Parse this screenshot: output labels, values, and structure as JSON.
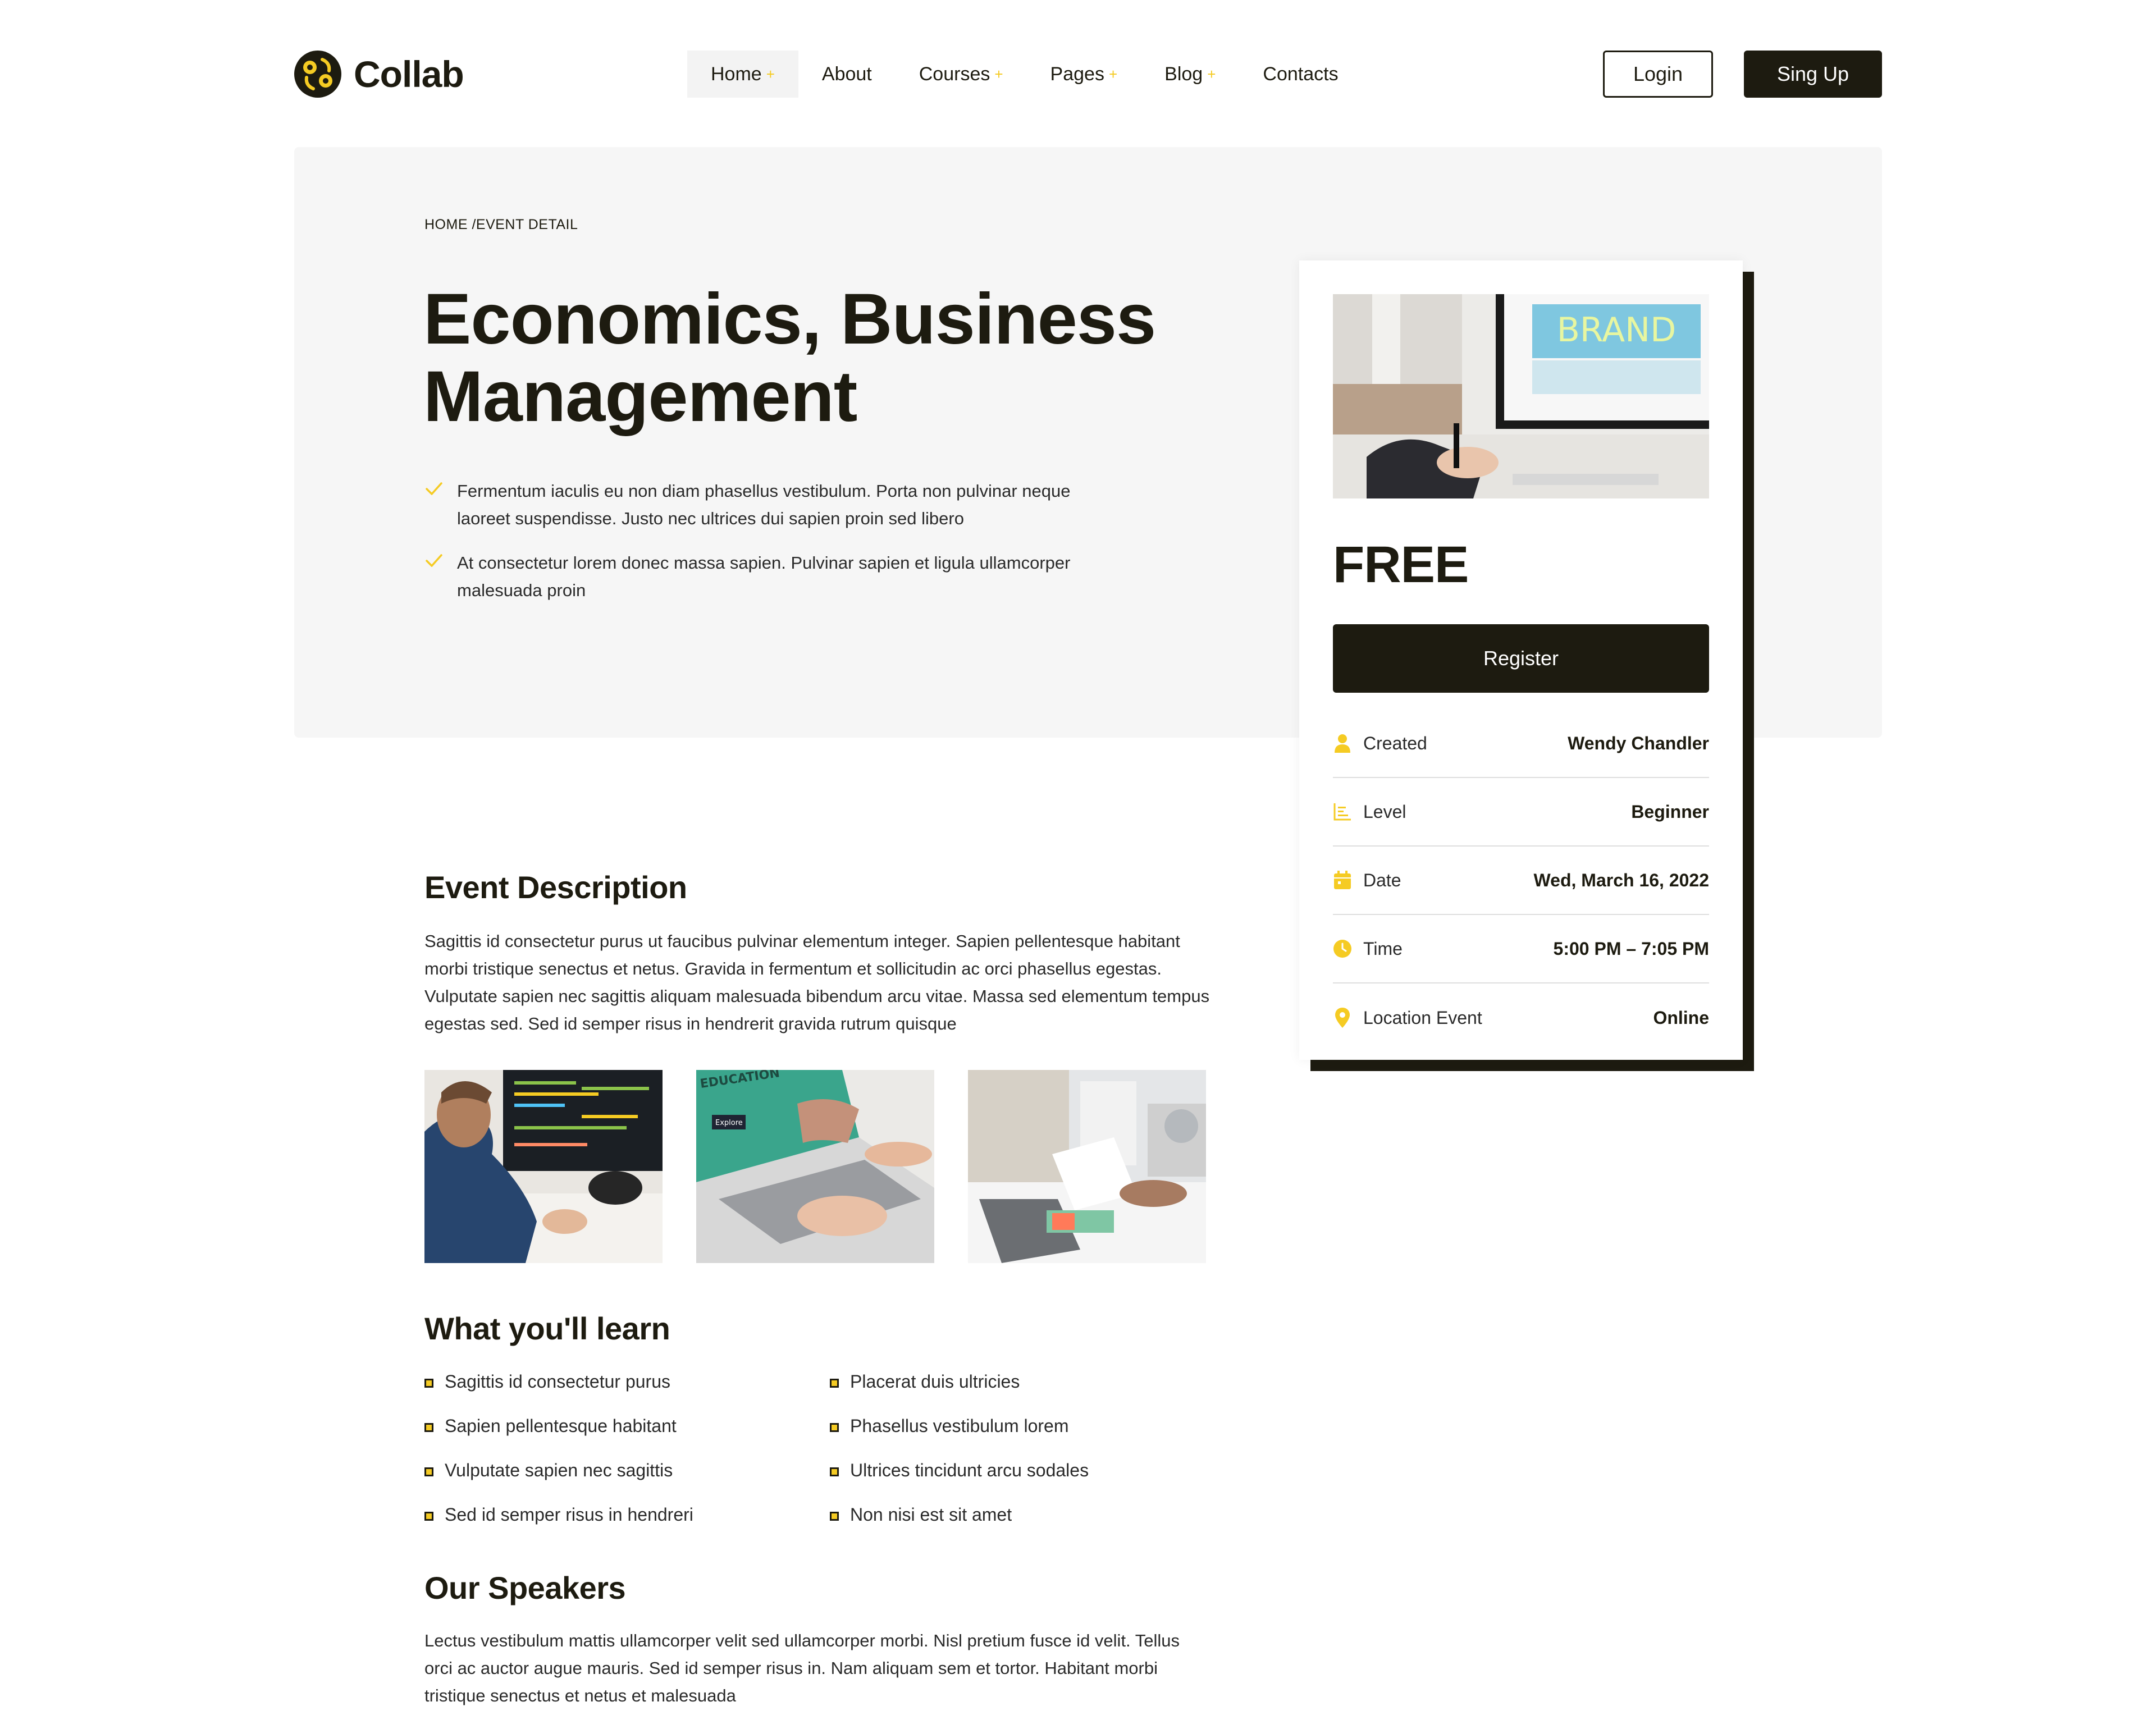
{
  "brand": {
    "name": "Collab",
    "logo_icon": "collab-logo-icon",
    "accent_color": "#f5cb23",
    "dark_color": "#1d1b10"
  },
  "nav": {
    "items": [
      {
        "label": "Home",
        "has_submenu": true,
        "active": true
      },
      {
        "label": "About",
        "has_submenu": false,
        "active": false
      },
      {
        "label": "Courses",
        "has_submenu": true,
        "active": false
      },
      {
        "label": "Pages",
        "has_submenu": true,
        "active": false
      },
      {
        "label": "Blog",
        "has_submenu": true,
        "active": false
      },
      {
        "label": "Contacts",
        "has_submenu": false,
        "active": false
      }
    ],
    "submenu_icon": "+",
    "login_label": "Login",
    "signup_label": "Sing Up"
  },
  "hero": {
    "breadcrumb": "HOME /EVENT DETAIL",
    "title_line1": "Economics, Business",
    "title_line2": "Management",
    "bullets": [
      "Fermentum iaculis eu non diam phasellus vestibulum. Porta non pulvinar neque laoreet suspendisse. Justo nec ultrices dui sapien proin sed libero",
      "At consectetur lorem donec massa sapien. Pulvinar sapien et ligula ullamcorper malesuada proin"
    ]
  },
  "event_card": {
    "image_text": "BRAND",
    "price": "FREE",
    "register_label": "Register",
    "details": [
      {
        "icon": "user-icon",
        "label": "Created",
        "value": "Wendy Chandler"
      },
      {
        "icon": "level-chart-icon",
        "label": "Level",
        "value": "Beginner"
      },
      {
        "icon": "calendar-icon",
        "label": "Date",
        "value": "Wed, March 16, 2022"
      },
      {
        "icon": "clock-icon",
        "label": "Time",
        "value": "5:00 PM – 7:05 PM"
      },
      {
        "icon": "location-pin-icon",
        "label": "Location Event",
        "value": "Online"
      }
    ]
  },
  "description": {
    "heading": "Event Description",
    "text": "Sagittis id consectetur purus ut faucibus pulvinar elementum integer. Sapien pellentesque habitant morbi tristique senectus et netus. Gravida in fermentum et sollicitudin ac orci phasellus egestas. Vulputate sapien nec sagittis aliquam malesuada bibendum arcu vitae. Massa sed elementum tempus egestas sed. Sed id semper risus in hendrerit gravida rutrum quisque"
  },
  "gallery": {
    "photo2_text_top": "EDUCATION",
    "photo2_text_button": "Explore"
  },
  "learn": {
    "heading": "What you'll learn",
    "col1": [
      "Sagittis id consectetur purus",
      "Sapien pellentesque habitant",
      "Vulputate sapien nec sagittis",
      "Sed id semper risus in hendreri"
    ],
    "col2": [
      "Placerat duis ultricies",
      "Phasellus vestibulum lorem",
      "Ultrices tincidunt arcu sodales",
      "Non nisi est sit amet"
    ]
  },
  "speakers": {
    "heading": "Our Speakers",
    "text": "Lectus vestibulum mattis ullamcorper velit sed ullamcorper morbi. Nisl pretium fusce id velit. Tellus orci ac auctor augue mauris. Sed id semper risus in. Nam aliquam sem et tortor. Habitant morbi tristique senectus et netus et malesuada"
  }
}
